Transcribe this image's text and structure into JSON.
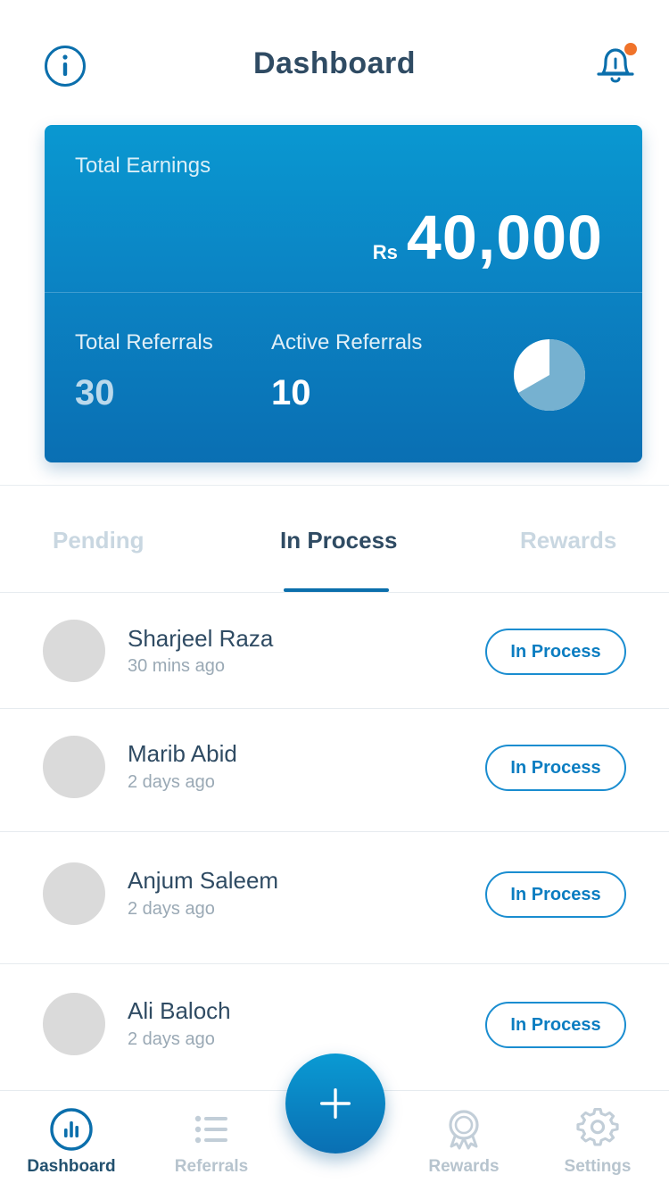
{
  "header": {
    "title": "Dashboard",
    "info_icon": "info-icon",
    "notification_icon": "bell-icon",
    "notification_dot_color": "#f0732a"
  },
  "earnings": {
    "label": "Total Earnings",
    "currency": "Rs",
    "amount": "40,000"
  },
  "referrals": {
    "total_label": "Total Referrals",
    "total_value": "30",
    "active_label": "Active Referrals",
    "active_value": "10",
    "active_fraction": 0.333
  },
  "tabs": [
    {
      "label": "Pending",
      "active": false
    },
    {
      "label": "In Process",
      "active": true
    },
    {
      "label": "Rewards",
      "active": false
    }
  ],
  "items": [
    {
      "name": "Sharjeel Raza",
      "time": "30 mins ago",
      "status": "In Process"
    },
    {
      "name": "Marib Abid",
      "time": "2 days ago",
      "status": "In Process"
    },
    {
      "name": "Anjum Saleem",
      "time": "2 days ago",
      "status": "In Process"
    },
    {
      "name": "Ali Baloch",
      "time": "2 days ago",
      "status": "In Process"
    }
  ],
  "nav": [
    {
      "label": "Dashboard",
      "icon": "chart-icon",
      "active": true
    },
    {
      "label": "Referrals",
      "icon": "list-icon",
      "active": false
    },
    {
      "label": "Rewards",
      "icon": "award-icon",
      "active": false
    },
    {
      "label": "Settings",
      "icon": "gear-icon",
      "active": false
    }
  ],
  "fab_icon": "plus-icon",
  "colors": {
    "accent": "#0b6fac",
    "card_top": "#0a98d1",
    "card_bottom": "#0a6fb3",
    "text_dark": "#2f4b63",
    "text_muted": "#9aa9b5"
  }
}
